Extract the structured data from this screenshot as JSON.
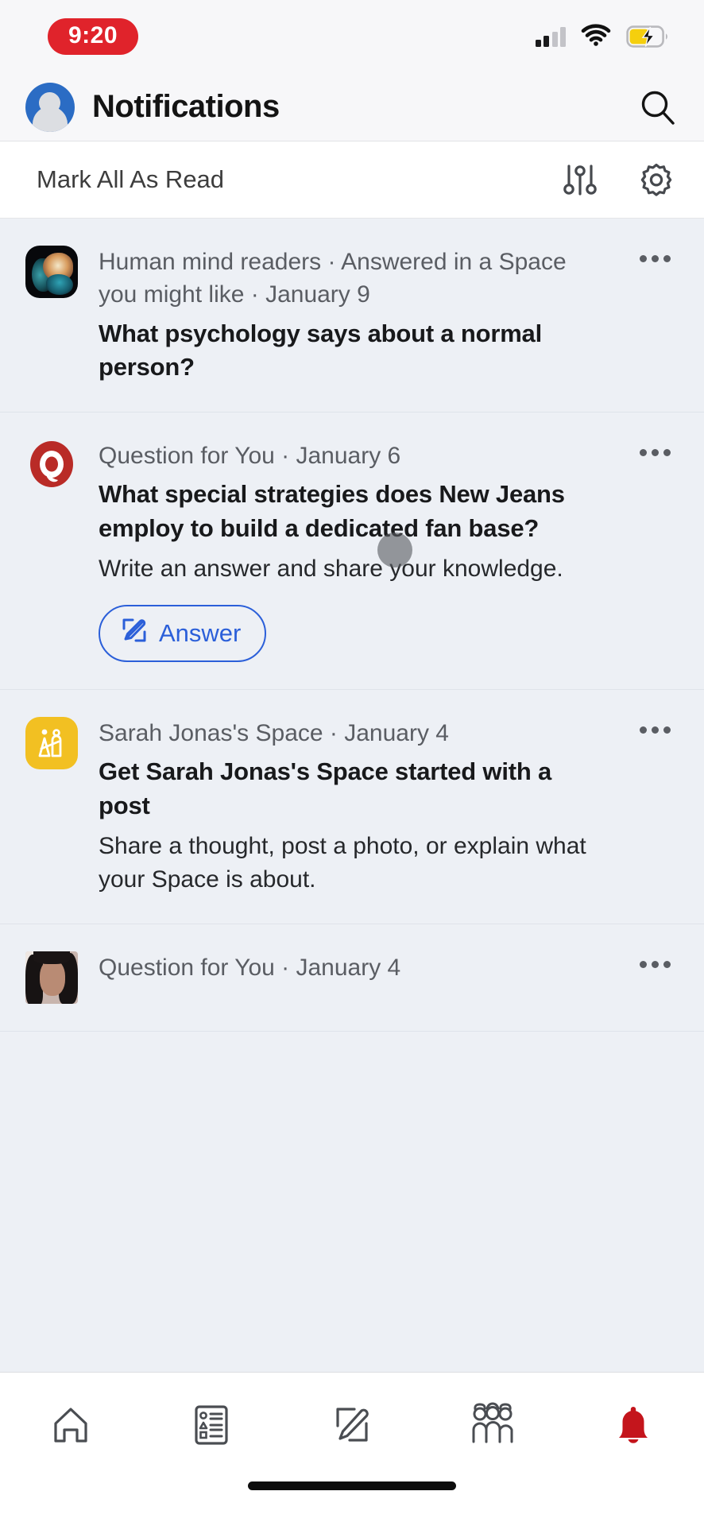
{
  "status_bar": {
    "time": "9:20",
    "time_pill_color": "#e0232b",
    "signal_icon": "cellular-signal-icon",
    "signal_bars_filled": 2,
    "signal_bars_total": 4,
    "wifi_icon": "wifi-icon",
    "battery_icon": "battery-charging-icon",
    "battery_color": "#f5cf0e",
    "battery_charging": true
  },
  "header": {
    "avatar_name": "user-avatar",
    "title": "Notifications",
    "search_label": "Search"
  },
  "toolbar": {
    "mark_all_read_label": "Mark All As Read",
    "filter_label": "Filter",
    "settings_label": "Settings"
  },
  "feed": {
    "background": "#edf0f5",
    "items": [
      {
        "icon": "brain-thumbnail",
        "meta": "Human mind readers · Answered in a Space you might like · January 9",
        "title": "What psychology says about a normal person?",
        "subtitle": "",
        "action_label": ""
      },
      {
        "icon": "quora-q-logo-icon",
        "meta": "Question for You · January 6",
        "title": "What special strategies does New Jeans employ to build a dedicated fan base?",
        "subtitle": "Write an answer and share your knowledge.",
        "action_label": "Answer"
      },
      {
        "icon": "space-group-icon",
        "meta": "Sarah Jonas's Space · January 4",
        "title": "Get Sarah Jonas's Space started with a post",
        "subtitle": "Share a thought, post a photo, or explain what your Space is about.",
        "action_label": ""
      },
      {
        "icon": "person-photo-thumbnail",
        "meta": "Question for You · January 4",
        "title": "",
        "subtitle": "",
        "action_label": ""
      }
    ],
    "more_options_label": "More options"
  },
  "tabbar": {
    "active_color": "#c4151c",
    "inactive_color": "#4a4d52",
    "tabs": [
      {
        "name": "home",
        "label": "Home",
        "active": false
      },
      {
        "name": "following",
        "label": "Following",
        "active": false
      },
      {
        "name": "answer",
        "label": "Answer",
        "active": false
      },
      {
        "name": "spaces",
        "label": "Spaces",
        "active": false
      },
      {
        "name": "notifications",
        "label": "Notifications",
        "active": true
      }
    ]
  },
  "colors": {
    "accent_blue": "#2b5fd9",
    "quora_red": "#b92b27",
    "space_yellow": "#f2c022"
  }
}
